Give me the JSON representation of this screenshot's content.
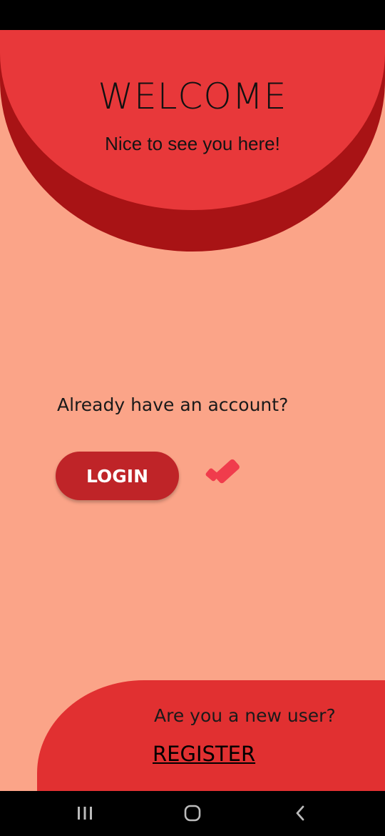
{
  "welcome": {
    "title": "WELCOME",
    "subtitle": "Nice to see you here!"
  },
  "login": {
    "prompt": "Already have an account?",
    "button_label": "LOGIN"
  },
  "register": {
    "prompt": "Are you a new user?",
    "link_label": "REGISTER"
  },
  "icons": {
    "decor": "checkmark-icon",
    "nav_recent": "recent-apps-icon",
    "nav_home": "home-icon",
    "nav_back": "back-icon"
  },
  "colors": {
    "background": "#FBA488",
    "header_light": "#E8383A",
    "header_dark": "#A81315",
    "button": "#BF2428",
    "bottom_panel": "#E13031",
    "checkmark": "#F03C4C"
  }
}
